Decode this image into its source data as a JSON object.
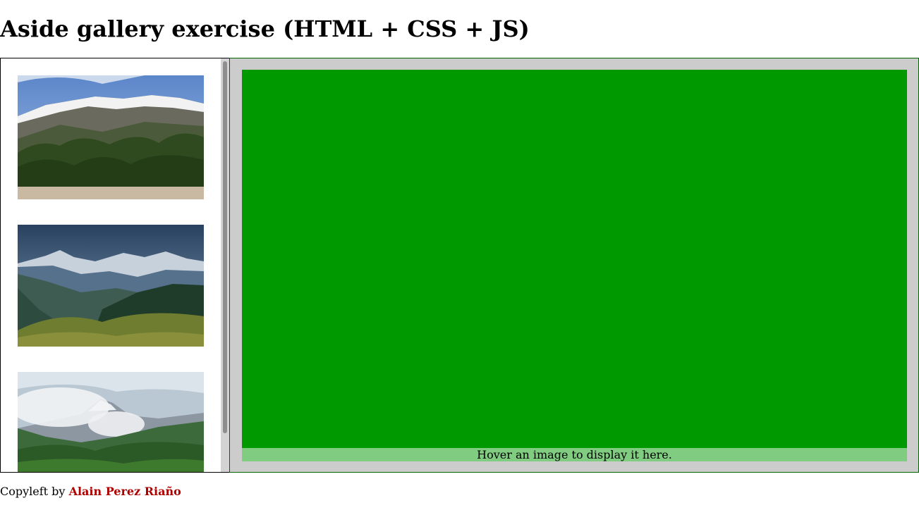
{
  "page": {
    "title": "Aside gallery exercise (HTML + CSS + JS)"
  },
  "gallery": {
    "thumbnails": [
      {
        "name": "mountain-snowy-ridge-forest"
      },
      {
        "name": "alpine-valley-peaks"
      },
      {
        "name": "misty-mountain-green-hills"
      }
    ]
  },
  "viewer": {
    "caption": "Hover an image to display it here.",
    "display_color": "#009900",
    "caption_bg": "#80cc80"
  },
  "footer": {
    "prefix": "Copyleft by",
    "author": "Alain Perez Riaño",
    "author_color": "#b00000"
  }
}
